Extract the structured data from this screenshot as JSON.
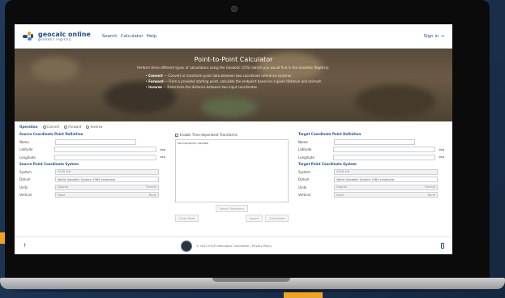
{
  "header": {
    "logo_title": "geocalc online",
    "logo_subtitle": "geodetic registry",
    "nav": [
      "Search",
      "Calculator",
      "Help"
    ],
    "signin_label": "Sign in"
  },
  "hero": {
    "title": "Point-to-Point Calculator",
    "intro": "Perform three different types of calculations using the Geodetic (CRS) (which you would find in the Geodetic Registry):",
    "items": [
      {
        "term": "Convert",
        "text": " — Convert or transform point data between two coordinate reference systems"
      },
      {
        "term": "Forward",
        "text": " — From a provided starting point, calculate the endpoint based on a given distance and azimuth"
      },
      {
        "term": "Inverse",
        "text": " — Determine the distance between two input coordinates"
      }
    ]
  },
  "operation": {
    "label": "Operation",
    "options": [
      "Convert",
      "Forward",
      "Inverse"
    ]
  },
  "source": {
    "title": "Source Coordinate Point Definition",
    "name_label": "Name",
    "lat_label": "Latitude",
    "lon_label": "Longitude",
    "unit": "deg",
    "system_title": "Source Point Coordinate System",
    "system_label": "System",
    "system_value": "4326 ##",
    "datum_label": "Datum",
    "datum_value": "World Geodetic System 1984 ensemble",
    "units_label": "Units",
    "units_value": "Degree",
    "units_right": "Format",
    "vertical_label": "Vertical",
    "vertical_value": "None",
    "vertical_right": "None"
  },
  "middle": {
    "enable_label": "Enable Time-dependent Transforms",
    "transform_text": "No transform needed",
    "select_button": "Select Transform",
    "clear_button": "Clear Data",
    "export_button": "Export",
    "calculate_button": "Calculate"
  },
  "target": {
    "title": "Target Coordinate Point Definition",
    "name_label": "Name",
    "lat_label": "Latitude",
    "lon_label": "Longitude",
    "unit": "deg",
    "system_title": "Target Point Coordinate System",
    "system_label": "System",
    "system_value": "4326 ##",
    "datum_label": "Datum",
    "datum_value": "World Geodetic System 1984 ensemble",
    "units_label": "Units",
    "units_value": "Degree",
    "units_right": "Format",
    "vertical_label": "Vertical",
    "vertical_value": "None",
    "vertical_right": "None"
  },
  "footer": {
    "text": "© 2022 IOGP Geomatics Committee | Privacy Policy"
  },
  "colors": {
    "accent": "#1f4f8a",
    "orange": "#f5a21b",
    "background": "#1c3351"
  }
}
